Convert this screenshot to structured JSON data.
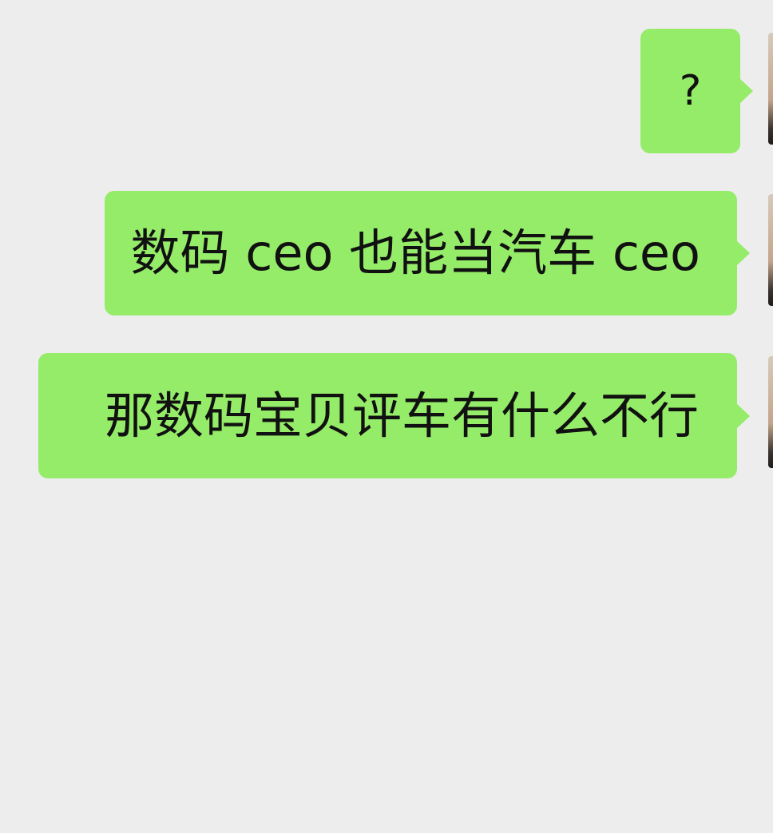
{
  "chat": {
    "messages": [
      {
        "sender": "self",
        "text": "?"
      },
      {
        "sender": "self",
        "text": "数码 ceo 也能当汽车 ceo"
      },
      {
        "sender": "self",
        "text": "那数码宝贝评车有什么不行"
      }
    ]
  },
  "colors": {
    "background": "#ededed",
    "bubble": "#95ec69",
    "text": "#111111"
  }
}
